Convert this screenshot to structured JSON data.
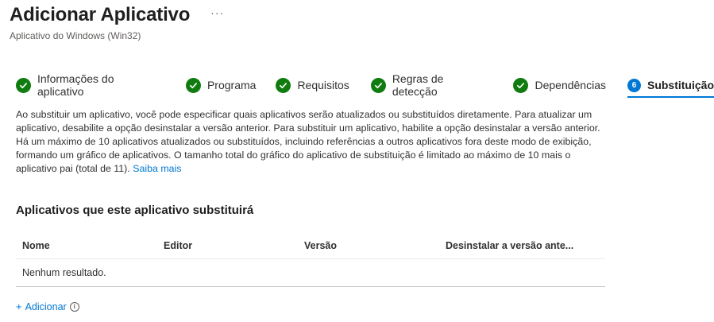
{
  "header": {
    "title": "Adicionar Aplicativo",
    "more": "···",
    "subtitle": "Aplicativo do Windows (Win32)"
  },
  "steps": [
    {
      "label": "Informações do aplicativo",
      "status": "complete"
    },
    {
      "label": "Programa",
      "status": "complete"
    },
    {
      "label": "Requisitos",
      "status": "complete"
    },
    {
      "label": "Regras de detecção",
      "status": "complete"
    },
    {
      "label": "Dependências",
      "status": "complete"
    },
    {
      "label": "Substituição",
      "status": "active",
      "number": "6"
    }
  ],
  "description": {
    "text": "Ao substituir um aplicativo, você pode especificar quais aplicativos serão atualizados ou substituídos diretamente. Para atualizar um aplicativo, desabilite a opção desinstalar a versão anterior. Para substituir um aplicativo, habilite a opção desinstalar a versão anterior. Há um máximo de 10 aplicativos atualizados ou substituídos, incluindo referências a outros aplicativos fora deste modo de exibição, formando um gráfico de aplicativos. O tamanho total do gráfico do aplicativo de substituição é limitado ao máximo de 10 mais o aplicativo pai (total de 11).",
    "link": "Saiba mais"
  },
  "section": {
    "title": "Aplicativos que este aplicativo substituirá"
  },
  "table": {
    "columns": [
      "Nome",
      "Editor",
      "Versão",
      "Desinstalar a versão ante..."
    ],
    "empty": "Nenhum resultado."
  },
  "actions": {
    "add_label": "Adicionar",
    "add_icon": "plus-icon",
    "info_icon": "info-icon"
  },
  "colors": {
    "complete": "#107c10",
    "accent": "#0078d4"
  }
}
